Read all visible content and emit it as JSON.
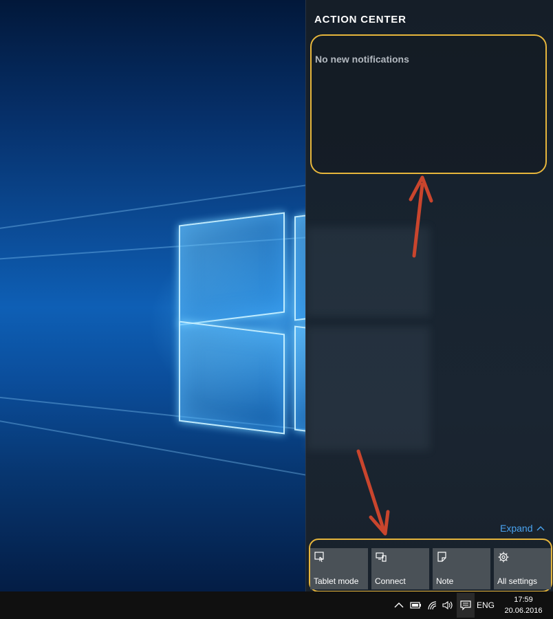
{
  "action_center": {
    "title": "ACTION CENTER",
    "notifications_text": "No new notifications",
    "expand_label": "Expand",
    "quick_actions": [
      {
        "label": "Tablet mode",
        "icon": "tablet-mode-icon"
      },
      {
        "label": "Connect",
        "icon": "connect-icon"
      },
      {
        "label": "Note",
        "icon": "note-icon"
      },
      {
        "label": "All settings",
        "icon": "gear-icon"
      }
    ]
  },
  "taskbar": {
    "language": "ENG",
    "time": "17:59",
    "date": "20.06.2016",
    "tray_icons": [
      "chevron-up-icon",
      "battery-icon",
      "wifi-icon",
      "volume-icon",
      "action-center-icon"
    ]
  },
  "colors": {
    "highlight": "#e7b63c",
    "arrow": "#c9452d",
    "accent": "#4aa3f0",
    "tile": "#4a5157"
  }
}
